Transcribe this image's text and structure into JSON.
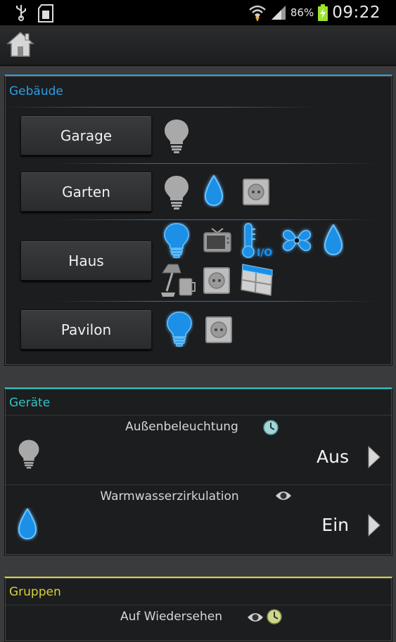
{
  "status_bar": {
    "battery_percent": "86%",
    "time": "09:22",
    "icons": [
      "usb-icon",
      "sd-card-icon",
      "wifi-icon",
      "signal-icon",
      "battery-charging-icon"
    ]
  },
  "action_bar": {
    "icon": "home-icon"
  },
  "buildings": {
    "title": "Gebäude",
    "accent": "#2f9de3",
    "items": [
      {
        "label": "Garage",
        "icons": [
          "bulb-off-icon"
        ]
      },
      {
        "label": "Garten",
        "icons": [
          "bulb-off-icon",
          "water-drop-on-icon",
          "power-socket-icon"
        ]
      },
      {
        "label": "Haus",
        "icons": [
          "bulb-on-icon",
          "tv-icon",
          "thermometer-io-icon",
          "fan-icon",
          "water-drop-on-icon",
          "kitchen-appliances-icon",
          "power-socket-icon",
          "window-blind-icon"
        ]
      },
      {
        "label": "Pavilon",
        "icons": [
          "bulb-on-icon",
          "power-socket-icon"
        ]
      }
    ]
  },
  "devices": {
    "title": "Geräte",
    "accent": "#2ec4c4",
    "items": [
      {
        "name": "Außenbeleuchtung",
        "state": "Aus",
        "icon": "bulb-off-icon",
        "badge": "clock-icon"
      },
      {
        "name": "Warmwasserzirkulation",
        "state": "Ein",
        "icon": "water-drop-on-icon",
        "badge": "eye-icon"
      }
    ]
  },
  "groups": {
    "title": "Gruppen",
    "accent": "#d6d13a",
    "items": [
      {
        "name": "Auf Wiedersehen",
        "badges": [
          "eye-icon",
          "clock-icon"
        ]
      }
    ]
  }
}
